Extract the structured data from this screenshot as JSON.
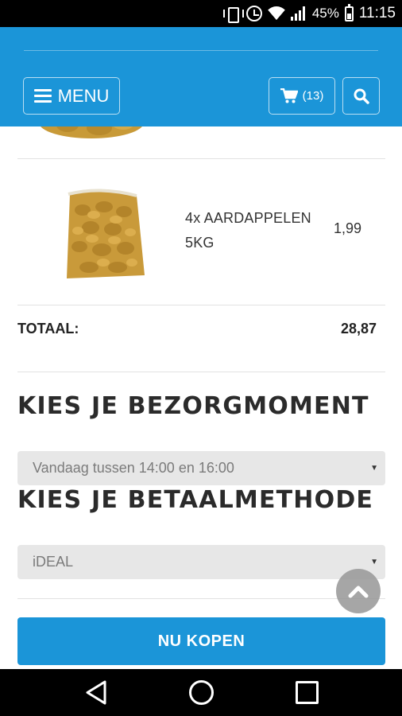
{
  "status_bar": {
    "battery_percent": "45%",
    "time": "11:15",
    "icons": [
      "vibrate-icon",
      "alarm-icon",
      "wifi-icon",
      "signal-icon",
      "battery-icon"
    ]
  },
  "header": {
    "menu_label": "MENU",
    "cart_count": "(13)",
    "background_color": "#1b95d8",
    "icons": [
      "hamburger-icon",
      "cart-icon",
      "search-icon"
    ]
  },
  "cart": {
    "items": [
      {
        "name": "4x AARDAPPELEN 5KG",
        "price": "1,99",
        "image": "potato-bag"
      }
    ],
    "total_label": "TOTAAL:",
    "total_value": "28,87"
  },
  "delivery": {
    "title": "KIES JE BEZORGMOMENT",
    "selected": "Vandaag tussen 14:00 en 16:00"
  },
  "payment": {
    "title": "KIES JE BETAALMETHODE",
    "selected": "iDEAL"
  },
  "buy_button": "NU KOPEN",
  "colors": {
    "accent": "#1b95d8",
    "select_bg": "#e7e7e7"
  }
}
